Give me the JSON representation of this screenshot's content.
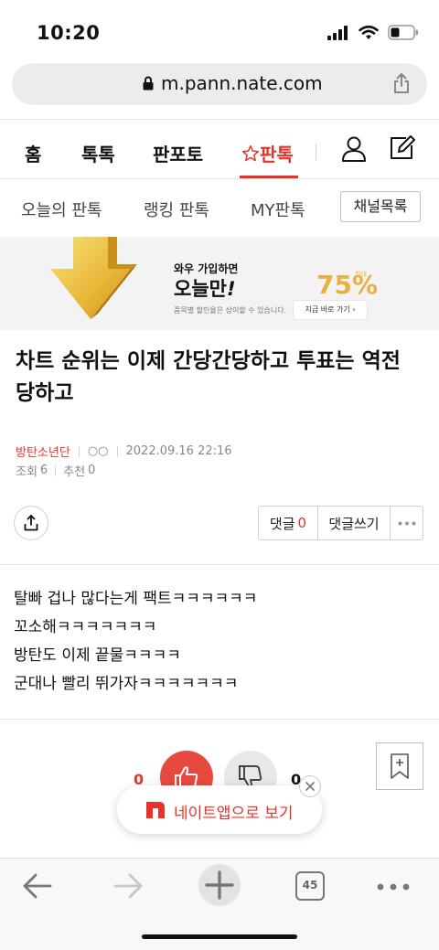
{
  "status_bar": {
    "time": "10:20"
  },
  "browser": {
    "url": "m.pann.nate.com"
  },
  "nav": {
    "home": "홈",
    "toktok": "톡톡",
    "panpoto": "판포토",
    "panntok": "판톡"
  },
  "subnav": {
    "today": "오늘의 판톡",
    "ranking": "랭킹 판톡",
    "my": "MY판톡",
    "channel_list": "채널목록"
  },
  "ad_banner": {
    "line1": "와우 가입하면",
    "line2": "오늘만",
    "line2_mark": "!",
    "fineprint": "품목별 할인율은 상이할 수 있습니다.",
    "percent": "75%",
    "max_label": "최대",
    "cta": "지금 바로 가기 ›"
  },
  "article": {
    "title": "차트 순위는 이제 간당간당하고 투표는 역전 당하고",
    "author": "방탄소년단",
    "writer": "○○",
    "datetime": "2022.09.16 22:16",
    "views_label": "조회",
    "views": "6",
    "recommend_label": "추천",
    "recommend": "0",
    "body_lines": [
      "탈빠 겁나 많다는게 팩트ㅋㅋㅋㅋㅋㅋ",
      "꼬소해ㅋㅋㅋㅋㅋㅋㅋ",
      "방탄도 이제 끝물ㅋㅋㅋㅋ",
      "군대나 빨리 뛰가자ㅋㅋㅋㅋㅋㅋㅋ"
    ]
  },
  "actions": {
    "comment_label": "댓글",
    "comment_count": "0",
    "write_comment": "댓글쓰기"
  },
  "vote": {
    "up_count": "0",
    "down_count": "0"
  },
  "app_banner": {
    "text": "네이트앱으로 보기"
  },
  "toolbar": {
    "tabs_count": "45"
  },
  "colors": {
    "accent": "#e8322b",
    "banner_gold": "#e8b13f"
  }
}
